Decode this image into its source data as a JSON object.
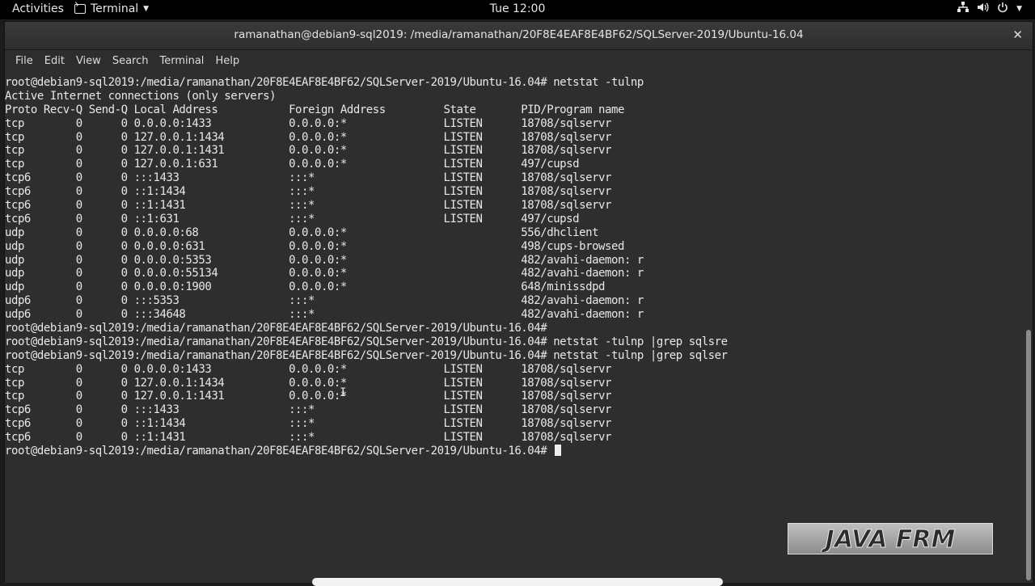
{
  "topbar": {
    "activities": "Activities",
    "app_name": "Terminal",
    "clock": "Tue 12:00",
    "status_icons": [
      "network-icon",
      "volume-icon",
      "power-icon"
    ]
  },
  "window": {
    "title": "ramanathan@debian9-sql2019: /media/ramanathan/20F8E4EAF8E4BF62/SQLServer-2019/Ubuntu-16.04",
    "menu": [
      "File",
      "Edit",
      "View",
      "Search",
      "Terminal",
      "Help"
    ]
  },
  "terminal": {
    "lines": [
      "root@debian9-sql2019:/media/ramanathan/20F8E4EAF8E4BF62/SQLServer-2019/Ubuntu-16.04# netstat -tulnp",
      "Active Internet connections (only servers)",
      "Proto Recv-Q Send-Q Local Address           Foreign Address         State       PID/Program name",
      "tcp        0      0 0.0.0.0:1433            0.0.0.0:*               LISTEN      18708/sqlservr",
      "tcp        0      0 127.0.0.1:1434          0.0.0.0:*               LISTEN      18708/sqlservr",
      "tcp        0      0 127.0.0.1:1431          0.0.0.0:*               LISTEN      18708/sqlservr",
      "tcp        0      0 127.0.0.1:631           0.0.0.0:*               LISTEN      497/cupsd",
      "tcp6       0      0 :::1433                 :::*                    LISTEN      18708/sqlservr",
      "tcp6       0      0 ::1:1434                :::*                    LISTEN      18708/sqlservr",
      "tcp6       0      0 ::1:1431                :::*                    LISTEN      18708/sqlservr",
      "tcp6       0      0 ::1:631                 :::*                    LISTEN      497/cupsd",
      "udp        0      0 0.0.0.0:68              0.0.0.0:*                           556/dhclient",
      "udp        0      0 0.0.0.0:631             0.0.0.0:*                           498/cups-browsed",
      "udp        0      0 0.0.0.0:5353            0.0.0.0:*                           482/avahi-daemon: r",
      "udp        0      0 0.0.0.0:55134           0.0.0.0:*                           482/avahi-daemon: r",
      "udp        0      0 0.0.0.0:1900            0.0.0.0:*                           648/minissdpd",
      "udp6       0      0 :::5353                 :::*                                482/avahi-daemon: r",
      "udp6       0      0 :::34648                :::*                                482/avahi-daemon: r",
      "root@debian9-sql2019:/media/ramanathan/20F8E4EAF8E4BF62/SQLServer-2019/Ubuntu-16.04#",
      "root@debian9-sql2019:/media/ramanathan/20F8E4EAF8E4BF62/SQLServer-2019/Ubuntu-16.04# netstat -tulnp |grep sqlsre",
      "root@debian9-sql2019:/media/ramanathan/20F8E4EAF8E4BF62/SQLServer-2019/Ubuntu-16.04# netstat -tulnp |grep sqlser",
      "tcp        0      0 0.0.0.0:1433            0.0.0.0:*               LISTEN      18708/sqlservr",
      "tcp        0      0 127.0.0.1:1434          0.0.0.0:*               LISTEN      18708/sqlservr",
      "tcp        0      0 127.0.0.1:1431          0.0.0.0:*               LISTEN      18708/sqlservr",
      "tcp6       0      0 :::1433                 :::*                    LISTEN      18708/sqlservr",
      "tcp6       0      0 ::1:1434                :::*                    LISTEN      18708/sqlservr",
      "tcp6       0      0 ::1:1431                :::*                    LISTEN      18708/sqlservr"
    ],
    "prompt": "root@debian9-sql2019:/media/ramanathan/20F8E4EAF8E4BF62/SQLServer-2019/Ubuntu-16.04# "
  },
  "watermark": {
    "text": "JAVA FRM"
  }
}
